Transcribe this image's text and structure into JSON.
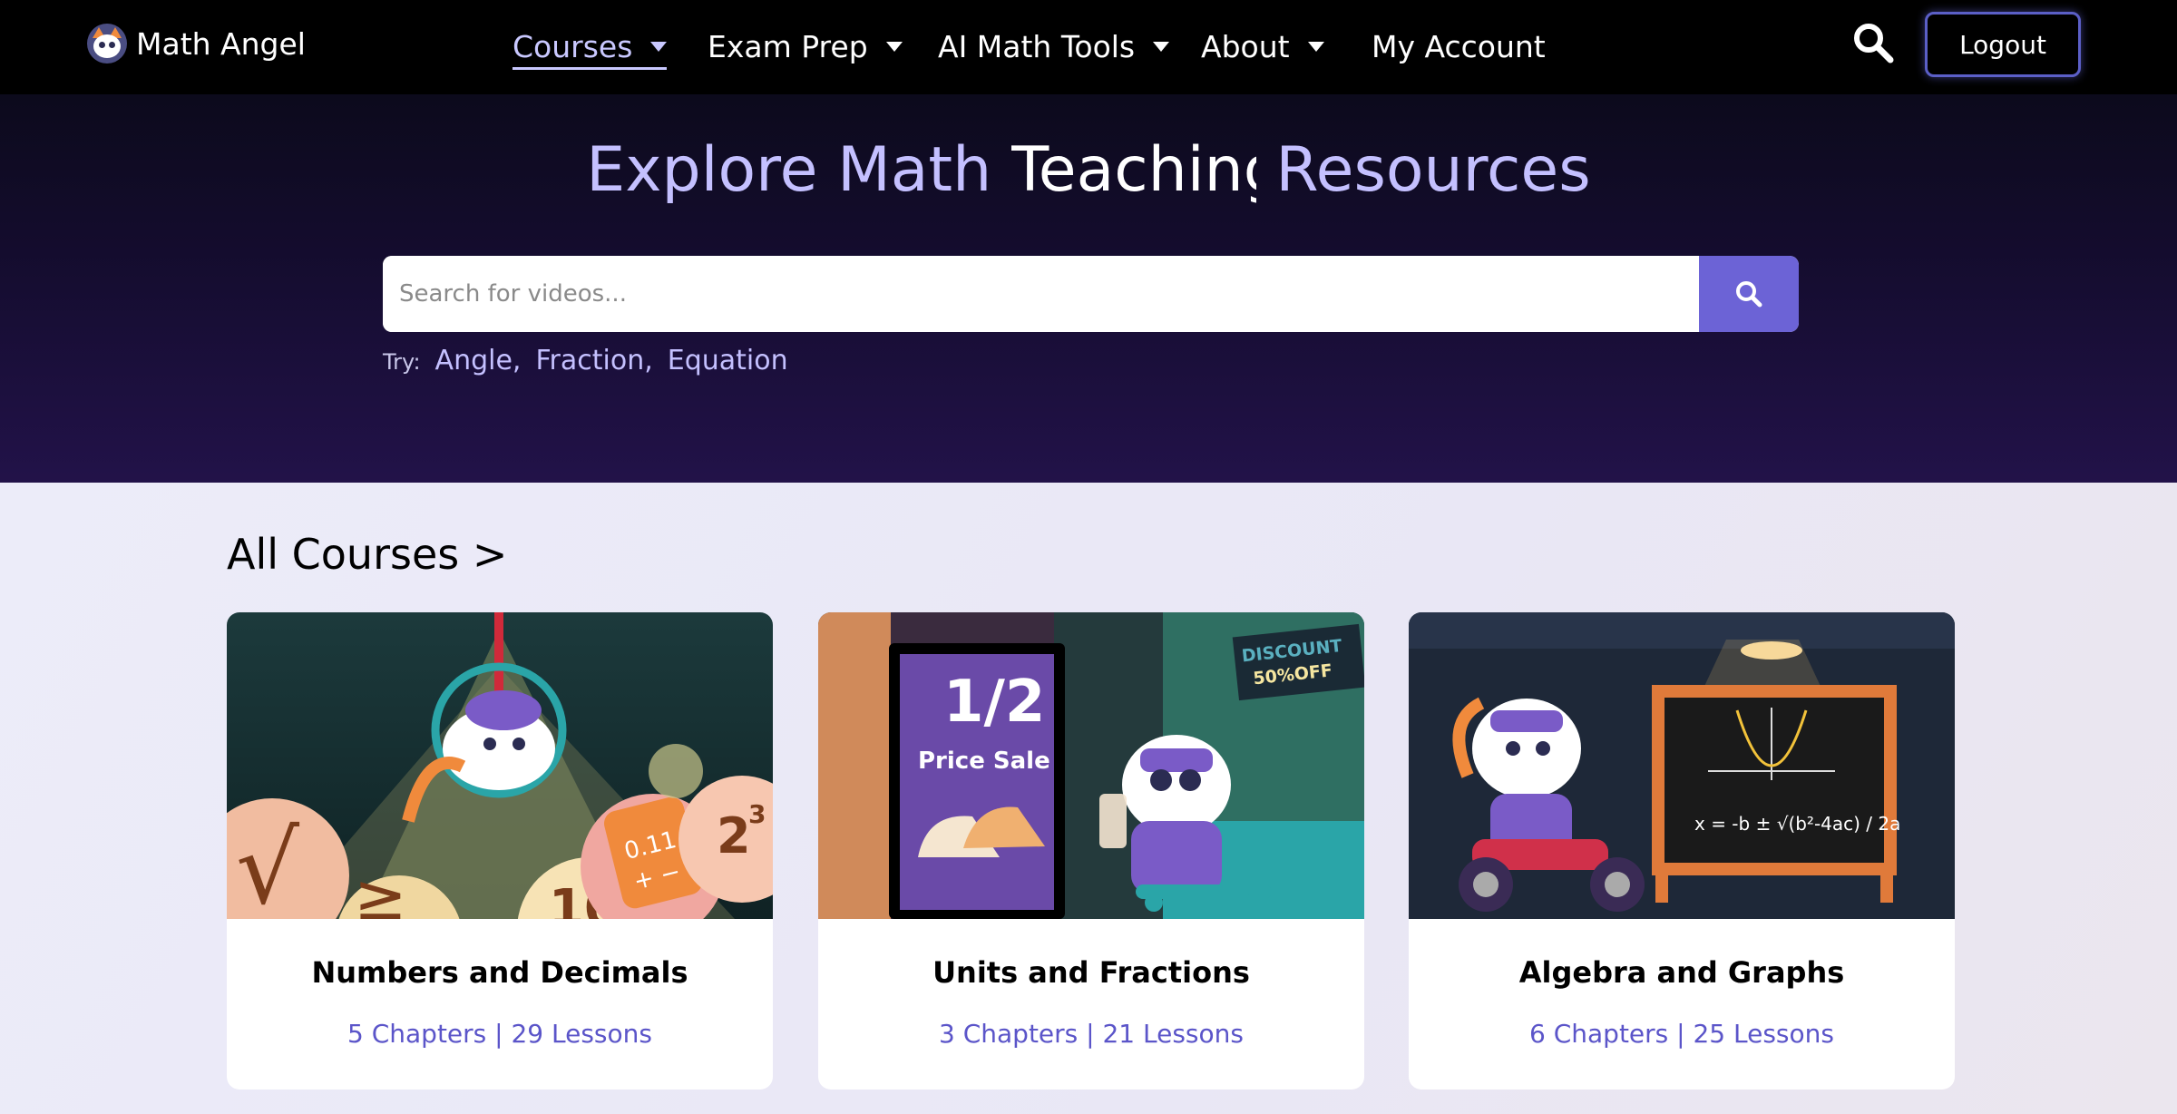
{
  "nav": {
    "logo_text": "Math Angel",
    "menu": [
      {
        "label": "Courses",
        "active": true,
        "dropdown": true
      },
      {
        "label": "Exam Prep",
        "dropdown": true
      },
      {
        "label": "AI Math Tools",
        "dropdown": true
      },
      {
        "label": "About",
        "dropdown": true
      },
      {
        "label": "My Account",
        "dropdown": false
      }
    ],
    "search_icon": "search-icon",
    "logout_label": "Logout"
  },
  "hero": {
    "title_part1": "Explore Math",
    "title_part2": "Teaching",
    "title_part3": "Resources",
    "search_placeholder": "Search for videos...",
    "try_label": "Try:",
    "suggestions": [
      "Angle,",
      "Fraction,",
      "Equation"
    ]
  },
  "courses": {
    "section_title": "All Courses >",
    "items": [
      {
        "title": "Numbers and Decimals",
        "meta": "5 Chapters | 29 Lessons"
      },
      {
        "title": "Units and Fractions",
        "meta": "3 Chapters | 21 Lessons",
        "image_text_fraction": "1/2",
        "image_text_sale": "Price Sale",
        "image_text_discount": "DISCOUNT",
        "image_text_off": "50%OFF"
      },
      {
        "title": "Algebra and Graphs",
        "meta": "6 Chapters | 25 Lessons",
        "image_text_formula": "x = -b ± √(b²-4ac) / 2a"
      }
    ]
  },
  "colors": {
    "accent": "#6c63d6",
    "accent_light": "#c4c0ff",
    "nav_bg": "#000000",
    "hero_bg_top": "#0c0a1c",
    "hero_bg_bottom": "#221249",
    "meta_text": "#5b55c9"
  }
}
